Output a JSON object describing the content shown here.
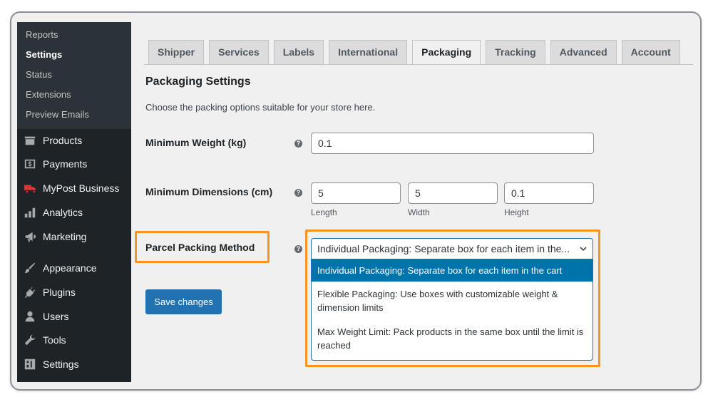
{
  "sidebar": {
    "submenu": [
      "Reports",
      "Settings",
      "Status",
      "Extensions",
      "Preview Emails"
    ],
    "submenu_active": "Settings",
    "items": [
      {
        "label": "Products",
        "icon": "products-icon"
      },
      {
        "label": "Payments",
        "icon": "payments-icon"
      },
      {
        "label": "MyPost Business",
        "icon": "truck-icon"
      },
      {
        "label": "Analytics",
        "icon": "analytics-icon"
      },
      {
        "label": "Marketing",
        "icon": "megaphone-icon"
      },
      {
        "label": "Appearance",
        "icon": "brush-icon"
      },
      {
        "label": "Plugins",
        "icon": "plug-icon"
      },
      {
        "label": "Users",
        "icon": "user-icon"
      },
      {
        "label": "Tools",
        "icon": "wrench-icon"
      },
      {
        "label": "Settings",
        "icon": "settings-icon"
      }
    ]
  },
  "tabs": [
    "Shipper",
    "Services",
    "Labels",
    "International",
    "Packaging",
    "Tracking",
    "Advanced",
    "Account"
  ],
  "active_tab": "Packaging",
  "section": {
    "title": "Packaging Settings",
    "description": "Choose the packing options suitable for your store here."
  },
  "fields": {
    "min_weight": {
      "label": "Minimum Weight (kg)",
      "value": "0.1"
    },
    "min_dimensions": {
      "label": "Minimum Dimensions (cm)",
      "length": {
        "value": "5",
        "caption": "Length"
      },
      "width": {
        "value": "5",
        "caption": "Width"
      },
      "height": {
        "value": "0.1",
        "caption": "Height"
      }
    },
    "packing_method": {
      "label": "Parcel Packing Method",
      "selected": "Individual Packaging: Separate box for each item in the...",
      "options": [
        "Individual Packaging: Separate box for each item in the cart",
        "Flexible Packaging: Use boxes with customizable weight & dimension limits",
        "Max Weight Limit: Pack products in the same box until the limit is reached"
      ]
    }
  },
  "save_label": "Save changes",
  "colors": {
    "accent": "#2271b1",
    "highlight": "#f7931e",
    "selected_option": "#0073aa"
  }
}
